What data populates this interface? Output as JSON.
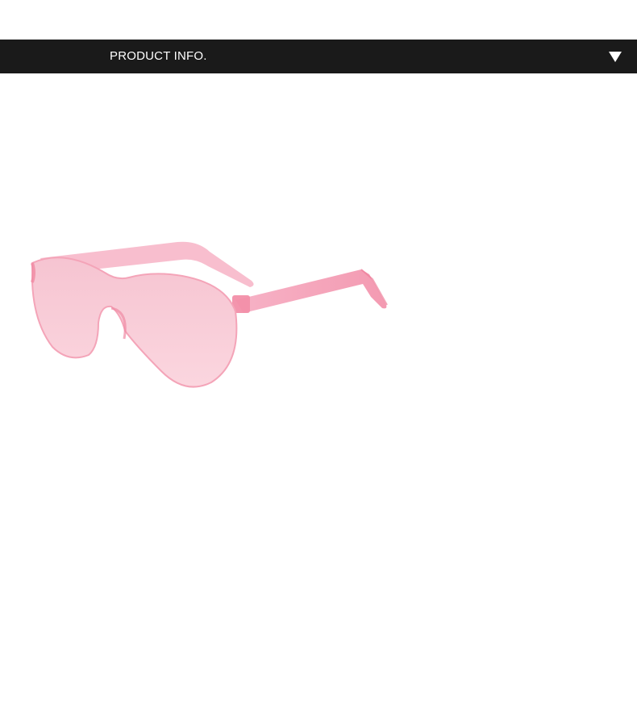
{
  "header": {
    "title": "PRODUCT INFO.",
    "toggle_icon": "triangle-down-icon",
    "background_color": "#1a1a1a",
    "text_color": "#ffffff"
  },
  "product_image": {
    "icon": "pink-sunglasses-image",
    "lens_color": "#f8c8d4",
    "frame_color": "#f5a0b4"
  }
}
